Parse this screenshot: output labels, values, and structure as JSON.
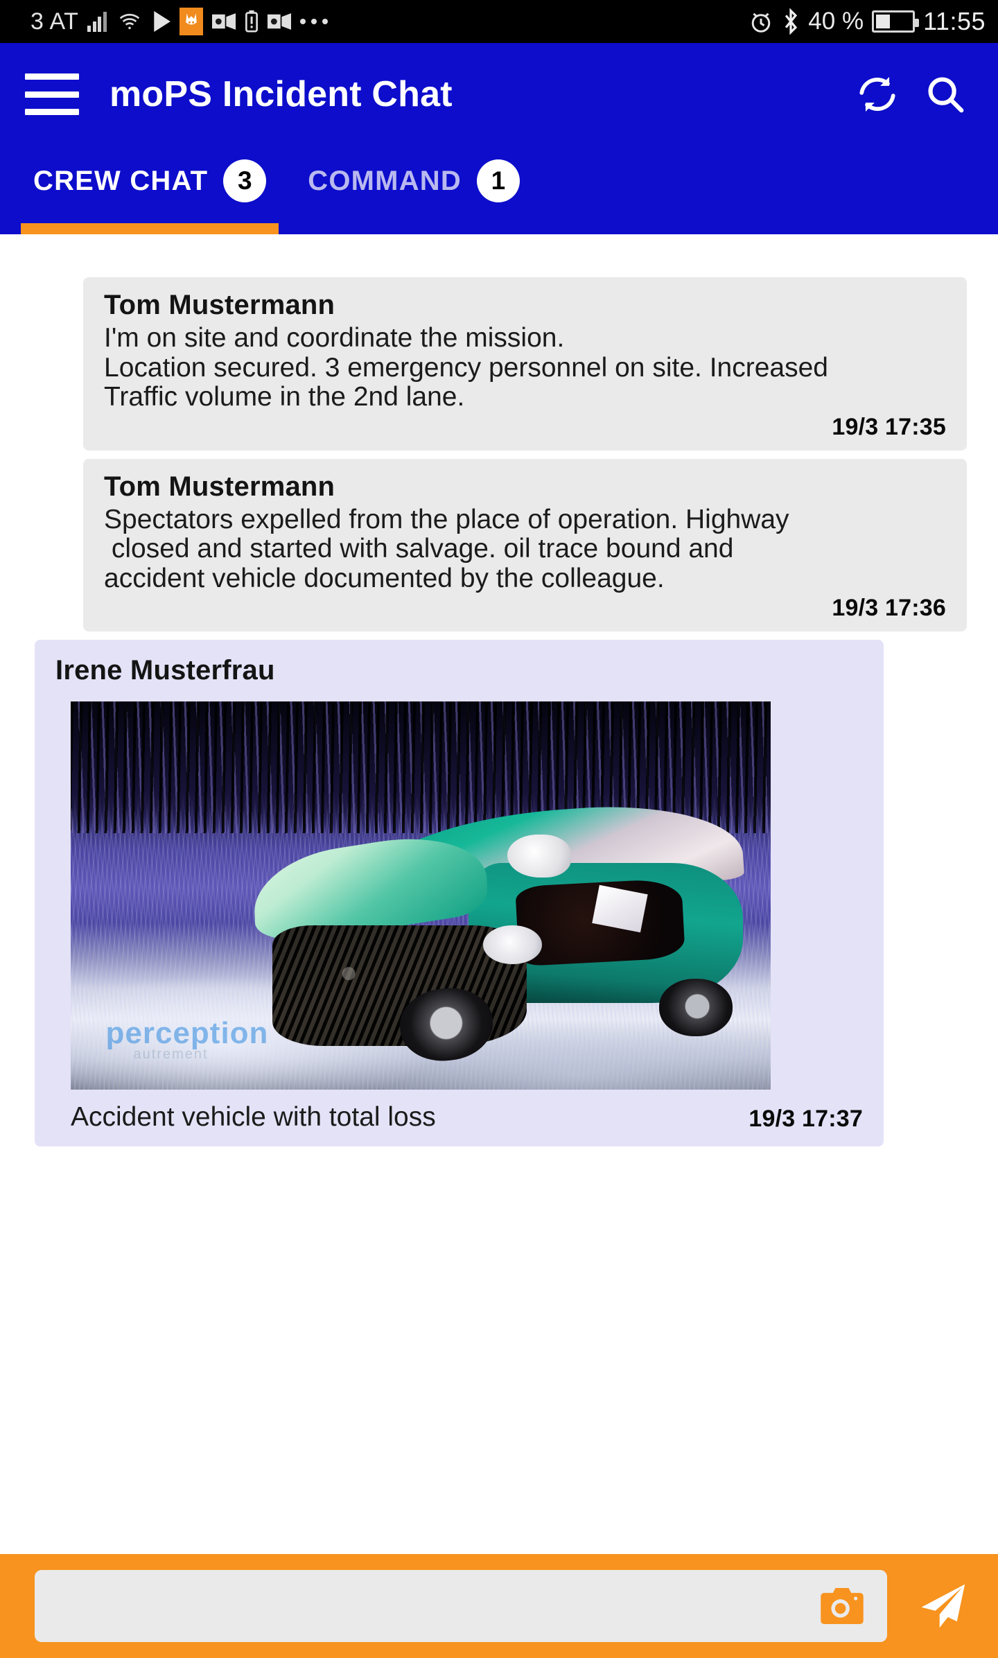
{
  "status_bar": {
    "carrier": "3 AT",
    "battery_percent": "40 %",
    "clock": "11:55",
    "icons": [
      "signal-bars-icon",
      "wifi-icon",
      "play-icon",
      "app-notification-icon",
      "outlook-icon",
      "battery-alert-icon",
      "outlook-icon",
      "more-icon",
      "alarm-icon",
      "bluetooth-icon",
      "battery-icon"
    ]
  },
  "app_bar": {
    "title": "moPS Incident Chat",
    "menu_icon": "hamburger-icon",
    "refresh_icon": "refresh-icon",
    "search_icon": "search-icon"
  },
  "tabs": [
    {
      "label": "CREW CHAT",
      "badge": "3",
      "active": true
    },
    {
      "label": "COMMAND",
      "badge": "1",
      "active": false
    }
  ],
  "messages": [
    {
      "author": "Tom  Mustermann",
      "lines": [
        "I'm on site and coordinate the mission.",
        "Location secured. 3 emergency personnel on site. Increased",
        "Traffic volume in the 2nd lane."
      ],
      "time": "19/3 17:35",
      "type": "text"
    },
    {
      "author": "Tom  Mustermann",
      "lines": [
        "Spectators expelled from the place of operation. Highway",
        " closed and started with salvage. oil trace bound and",
        "accident vehicle documented by the colleague."
      ],
      "time": "19/3 17:36",
      "type": "text"
    },
    {
      "author": "Irene Musterfrau",
      "caption": "Accident vehicle with total loss",
      "time": "19/3 17:37",
      "type": "photo",
      "photo_alt": "crashed green car at night on roadside",
      "photo_watermark": "perception",
      "photo_watermark_sub": "autrement"
    }
  ],
  "composer": {
    "input_value": "",
    "input_placeholder": "",
    "camera_icon": "camera-icon",
    "send_icon": "send-icon"
  },
  "colors": {
    "app_bar_blue": "#0D0DCB",
    "accent_orange": "#F7931E",
    "bubble_gray": "#EAEAEA",
    "bubble_lavender": "#E4E2F7",
    "status_bar_black": "#000000"
  }
}
